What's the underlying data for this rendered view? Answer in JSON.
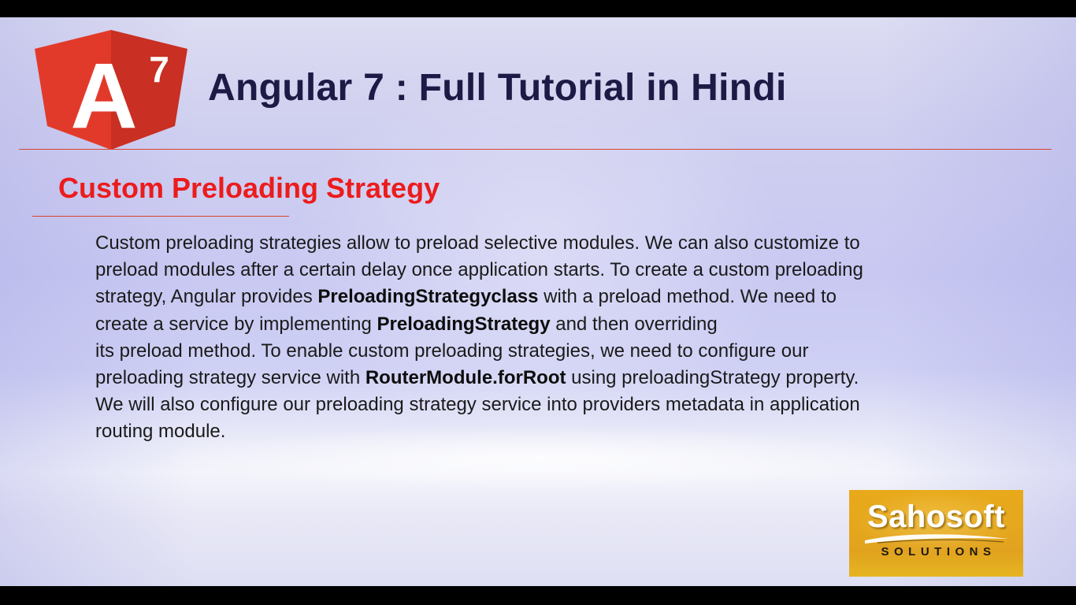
{
  "header": {
    "logo": {
      "letter": "A",
      "version": "7",
      "icon": "angular-logo-icon",
      "color": "#dd3b2b"
    },
    "title": "Angular 7 : Full Tutorial in Hindi"
  },
  "section": {
    "title": "Custom Preloading Strategy",
    "title_color": "#ec1c1c"
  },
  "content": {
    "lines": [
      [
        {
          "text": "Custom preloading strategies allow to preload selective modules. We can also customize to",
          "bold": false
        }
      ],
      [
        {
          "text": "preload modules after a certain delay once application starts. To create a custom preloading",
          "bold": false
        }
      ],
      [
        {
          "text": "strategy, Angular provides ",
          "bold": false
        },
        {
          "text": "PreloadingStrategyclass",
          "bold": true
        },
        {
          "text": " with a preload method. We need to",
          "bold": false
        }
      ],
      [
        {
          "text": "create a service by implementing ",
          "bold": false
        },
        {
          "text": "PreloadingStrategy",
          "bold": true
        },
        {
          "text": " and then overriding",
          "bold": false
        }
      ],
      [
        {
          "text": "its preload method. To enable custom preloading strategies, we need to configure our",
          "bold": false
        }
      ],
      [
        {
          "text": "preloading strategy service with ",
          "bold": false
        },
        {
          "text": "RouterModule.forRoot",
          "bold": true
        },
        {
          "text": " using preloadingStrategy property.",
          "bold": false
        }
      ],
      [
        {
          "text": "We will also configure our preloading strategy service into providers metadata in application",
          "bold": false
        }
      ],
      [
        {
          "text": "routing module.",
          "bold": false
        }
      ]
    ]
  },
  "brand": {
    "name": "Sahosoft",
    "subtitle": "SOLUTIONS",
    "icon": "sahosoft-logo-icon",
    "color": "#e5a71d"
  }
}
